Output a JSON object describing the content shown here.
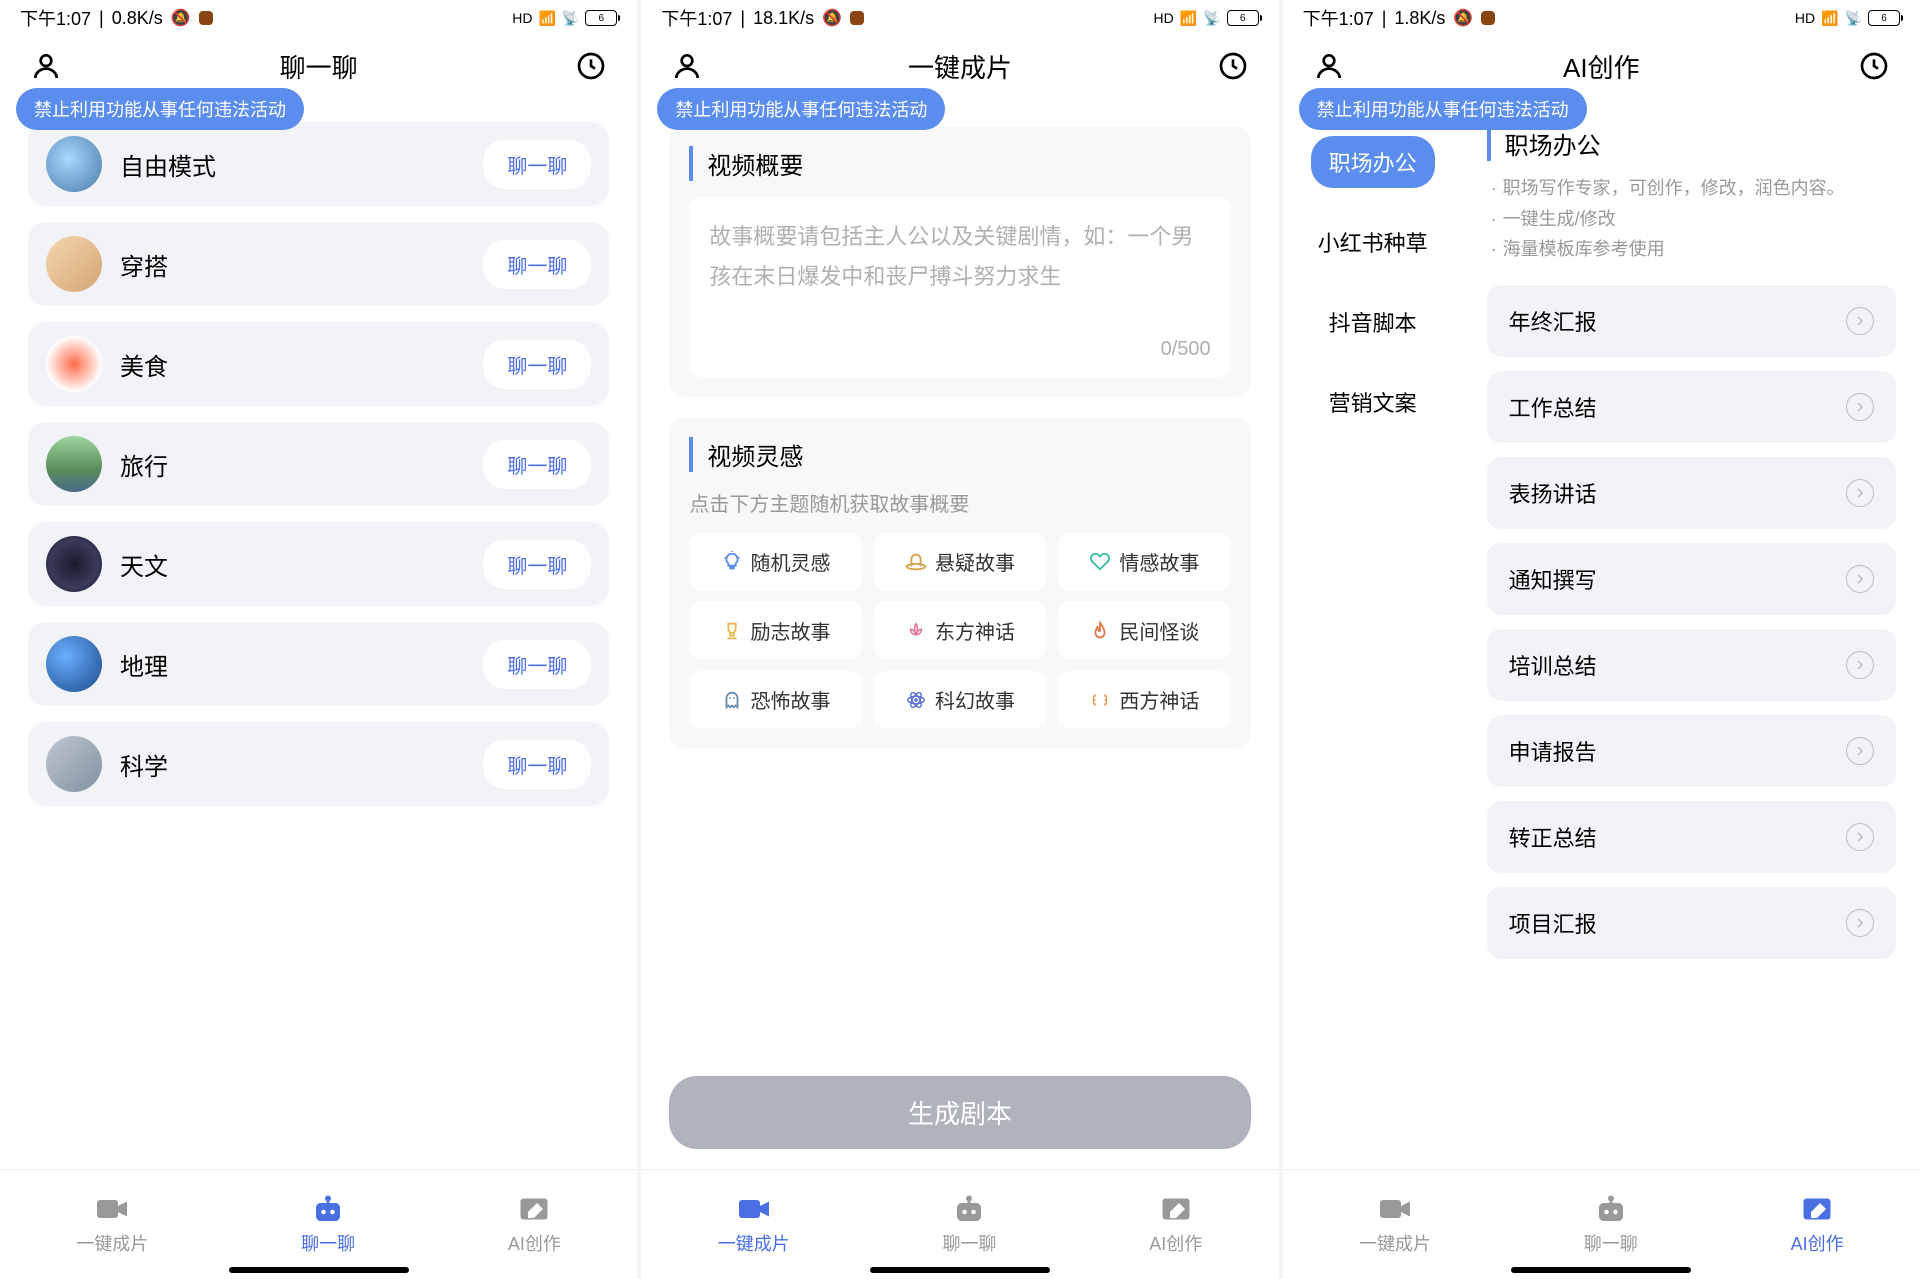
{
  "screens": [
    {
      "status": {
        "time": "下午1:07",
        "speed": "0.8K/s",
        "battery": "6"
      },
      "title": "聊一聊",
      "warning": "禁止利用功能从事任何违法活动",
      "chat_items": [
        {
          "name": "自由模式",
          "btn": "聊一聊"
        },
        {
          "name": "穿搭",
          "btn": "聊一聊"
        },
        {
          "name": "美食",
          "btn": "聊一聊"
        },
        {
          "name": "旅行",
          "btn": "聊一聊"
        },
        {
          "name": "天文",
          "btn": "聊一聊"
        },
        {
          "name": "地理",
          "btn": "聊一聊"
        },
        {
          "name": "科学",
          "btn": "聊一聊"
        }
      ],
      "nav": {
        "items": [
          "一键成片",
          "聊一聊",
          "AI创作"
        ],
        "active": 1
      }
    },
    {
      "status": {
        "time": "下午1:07",
        "speed": "18.1K/s",
        "battery": "6"
      },
      "title": "一键成片",
      "warning": "禁止利用功能从事任何违法活动",
      "video_summary": {
        "title": "视频概要",
        "placeholder": "故事概要请包括主人公以及关键剧情，如：一个男孩在末日爆发中和丧尸搏斗努力求生",
        "count": "0/500"
      },
      "inspiration": {
        "title": "视频灵感",
        "sub": "点击下方主题随机获取故事概要",
        "tags": [
          "随机灵感",
          "悬疑故事",
          "情感故事",
          "励志故事",
          "东方神话",
          "民间怪谈",
          "恐怖故事",
          "科幻故事",
          "西方神话"
        ]
      },
      "generate_btn": "生成剧本",
      "nav": {
        "items": [
          "一键成片",
          "聊一聊",
          "AI创作"
        ],
        "active": 0
      }
    },
    {
      "status": {
        "time": "下午1:07",
        "speed": "1.8K/s",
        "battery": "6"
      },
      "title": "AI创作",
      "warning": "禁止利用功能从事任何违法活动",
      "sidebar": {
        "tabs": [
          "职场办公",
          "小红书种草",
          "抖音脚本",
          "营销文案"
        ],
        "active": 0
      },
      "main": {
        "title": "职场办公",
        "desc": [
          "职场写作专家，可创作，修改，润色内容。",
          "一键生成/修改",
          "海量模板库参考使用"
        ],
        "items": [
          "年终汇报",
          "工作总结",
          "表扬讲话",
          "通知撰写",
          "培训总结",
          "申请报告",
          "转正总结",
          "项目汇报"
        ]
      },
      "nav": {
        "items": [
          "一键成片",
          "聊一聊",
          "AI创作"
        ],
        "active": 2
      }
    }
  ],
  "tag_colors": [
    "#5B8DEF",
    "#D4A24A",
    "#3DBFA0",
    "#E8B84A",
    "#E06B8C",
    "#E07B4A",
    "#6B8CB0",
    "#5B6FD4",
    "#E8944A"
  ]
}
